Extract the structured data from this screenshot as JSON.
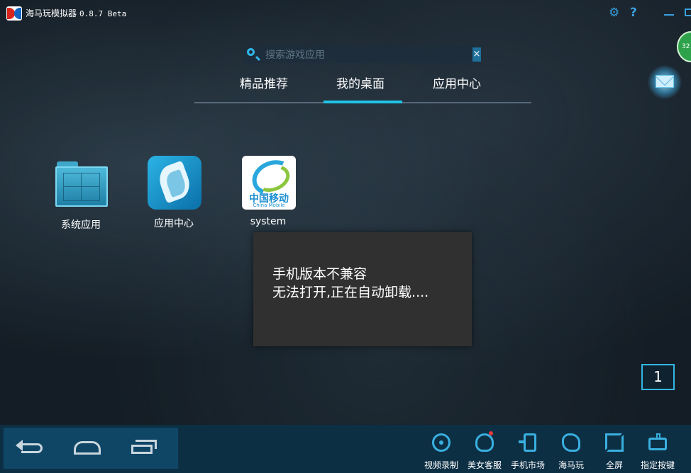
{
  "window": {
    "title": "海马玩模拟器",
    "version": "0.8.7 Beta"
  },
  "search": {
    "placeholder": "搜索游戏应用",
    "clear_label": "×"
  },
  "tabs": [
    {
      "label": "精品推荐",
      "active": false
    },
    {
      "label": "我的桌面",
      "active": true
    },
    {
      "label": "应用中心",
      "active": false
    }
  ],
  "side": {
    "badge_text": "32"
  },
  "desktop_icons": [
    {
      "label": "系统应用",
      "icon": "folder-icon"
    },
    {
      "label": "应用中心",
      "icon": "app-center-icon"
    },
    {
      "label": "system",
      "icon": "china-mobile-icon",
      "logo_text": "中国移动",
      "logo_sub": "China Mobile"
    }
  ],
  "toast": {
    "line1": "手机版本不兼容",
    "line2": "无法打开,正在自动卸载...."
  },
  "page_indicator": "1",
  "toolbar": [
    {
      "label": "视频录制",
      "icon": "camera-icon"
    },
    {
      "label": "美女客服",
      "icon": "customer-service-icon"
    },
    {
      "label": "手机市场",
      "icon": "phone-market-icon"
    },
    {
      "label": "海马玩",
      "icon": "haimawan-icon"
    },
    {
      "label": "全屏",
      "icon": "fullscreen-icon"
    },
    {
      "label": "指定按键",
      "icon": "keymap-icon"
    }
  ],
  "colors": {
    "accent": "#1fc5e8",
    "bottom_bar": "#0d2f44",
    "nav_area": "#0f4666",
    "toast_bg": "#303030"
  }
}
